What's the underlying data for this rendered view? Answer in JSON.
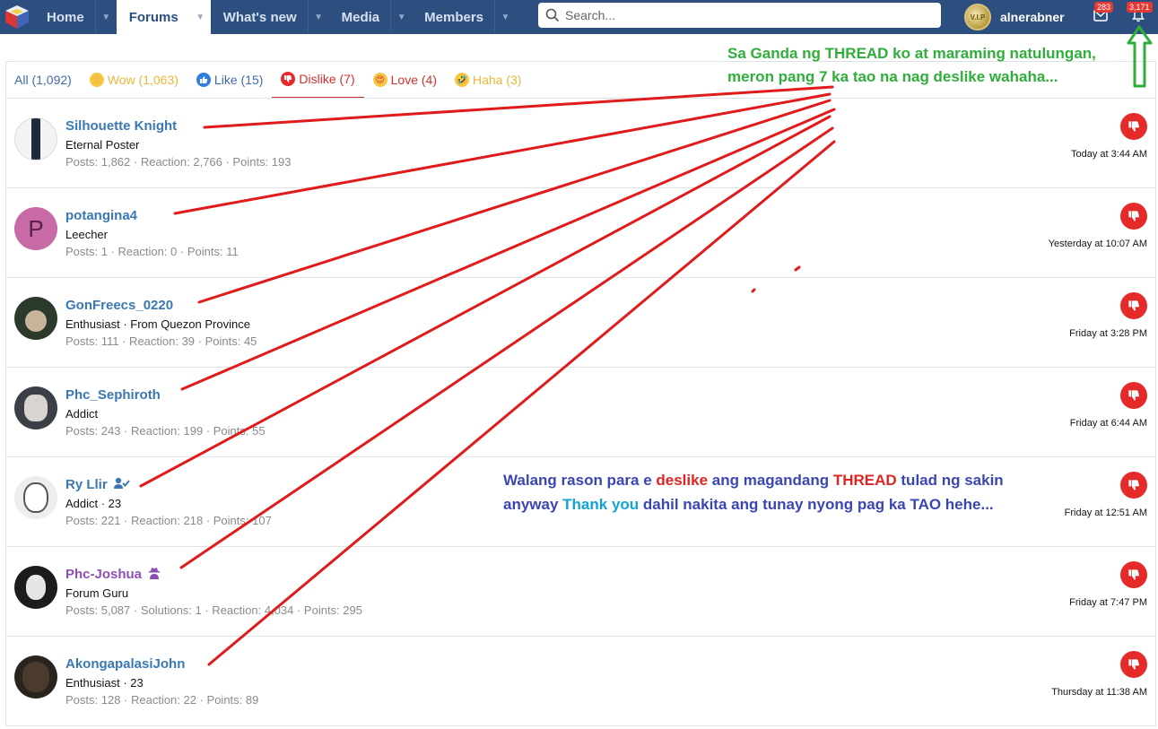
{
  "nav": {
    "tabs": [
      {
        "label": "Home"
      },
      {
        "label": "Forums"
      },
      {
        "label": "What's new"
      },
      {
        "label": "Media"
      },
      {
        "label": "Members"
      }
    ],
    "search_placeholder": "Search...",
    "username": "alnerabner",
    "avatar_text": "V.I.P",
    "inbox_badge": "283",
    "alerts_badge": "3,171"
  },
  "reaction_tabs": [
    {
      "label": "All (1,092)"
    },
    {
      "label": "Wow (1,063)",
      "icon": "wow-emoji-icon"
    },
    {
      "label": "Like (15)",
      "icon": "like-icon"
    },
    {
      "label": "Dislike (7)",
      "icon": "dislike-icon"
    },
    {
      "label": "Love (4)",
      "icon": "love-emoji-icon"
    },
    {
      "label": "Haha (3)",
      "icon": "haha-emoji-icon"
    }
  ],
  "members": [
    {
      "name": "Silhouette Knight",
      "title": "Eternal Poster",
      "stats": "Posts: 1,862 · Reaction: 2,766 · Points: 193",
      "time": "Today at 3:44 AM"
    },
    {
      "name": "potangina4",
      "title": "Leecher",
      "stats": "Posts: 1 · Reaction: 0 · Points: 11",
      "time": "Yesterday at 10:07 AM",
      "avatar_letter": "P"
    },
    {
      "name": "GonFreecs_0220",
      "title": "Enthusiast · From Quezon Province",
      "stats": "Posts: 111 · Reaction: 39 · Points: 45",
      "time": "Friday at 3:28 PM"
    },
    {
      "name": "Phc_Sephiroth",
      "title": "Addict",
      "stats": "Posts: 243 · Reaction: 199 · Points: 55",
      "time": "Friday at 6:44 AM"
    },
    {
      "name": "Ry Llir",
      "title": "Addict · 23",
      "stats": "Posts: 221 · Reaction: 218 · Points: 107",
      "time": "Friday at 12:51 AM"
    },
    {
      "name": "Phc-Joshua",
      "title": "Forum Guru",
      "stats": "Posts: 5,087 · Solutions: 1 · Reaction: 4,034 · Points: 295",
      "time": "Friday at 7:47 PM"
    },
    {
      "name": "AkongapalasiJohn",
      "title": "Enthusiast · 23",
      "stats": "Posts: 128 · Reaction: 22 · Points: 89",
      "time": "Thursday at 11:38 AM"
    }
  ],
  "annotation_top": {
    "line1": "Sa Ganda ng THREAD ko at maraming natulungan,",
    "line2": "meron pang 7 ka tao na nag deslike wahaha..."
  },
  "annotation_bottom": {
    "l1_a": "Walang rason para e ",
    "l1_b": "deslike",
    "l1_c": " ang magandang ",
    "l1_d": "THREAD",
    "l1_e": " tulad ng sakin",
    "l2_a": "anyway ",
    "l2_b": "Thank you",
    "l2_c": " dahil nakita ang tunay nyong pag ka TAO hehe..."
  },
  "colors": {
    "nav_bg": "#2d4f80",
    "link_blue": "#3a78b4",
    "dislike_red": "#e62a2a",
    "annotation_green": "#2fae3a",
    "annotation_blue": "#3b46b5"
  }
}
